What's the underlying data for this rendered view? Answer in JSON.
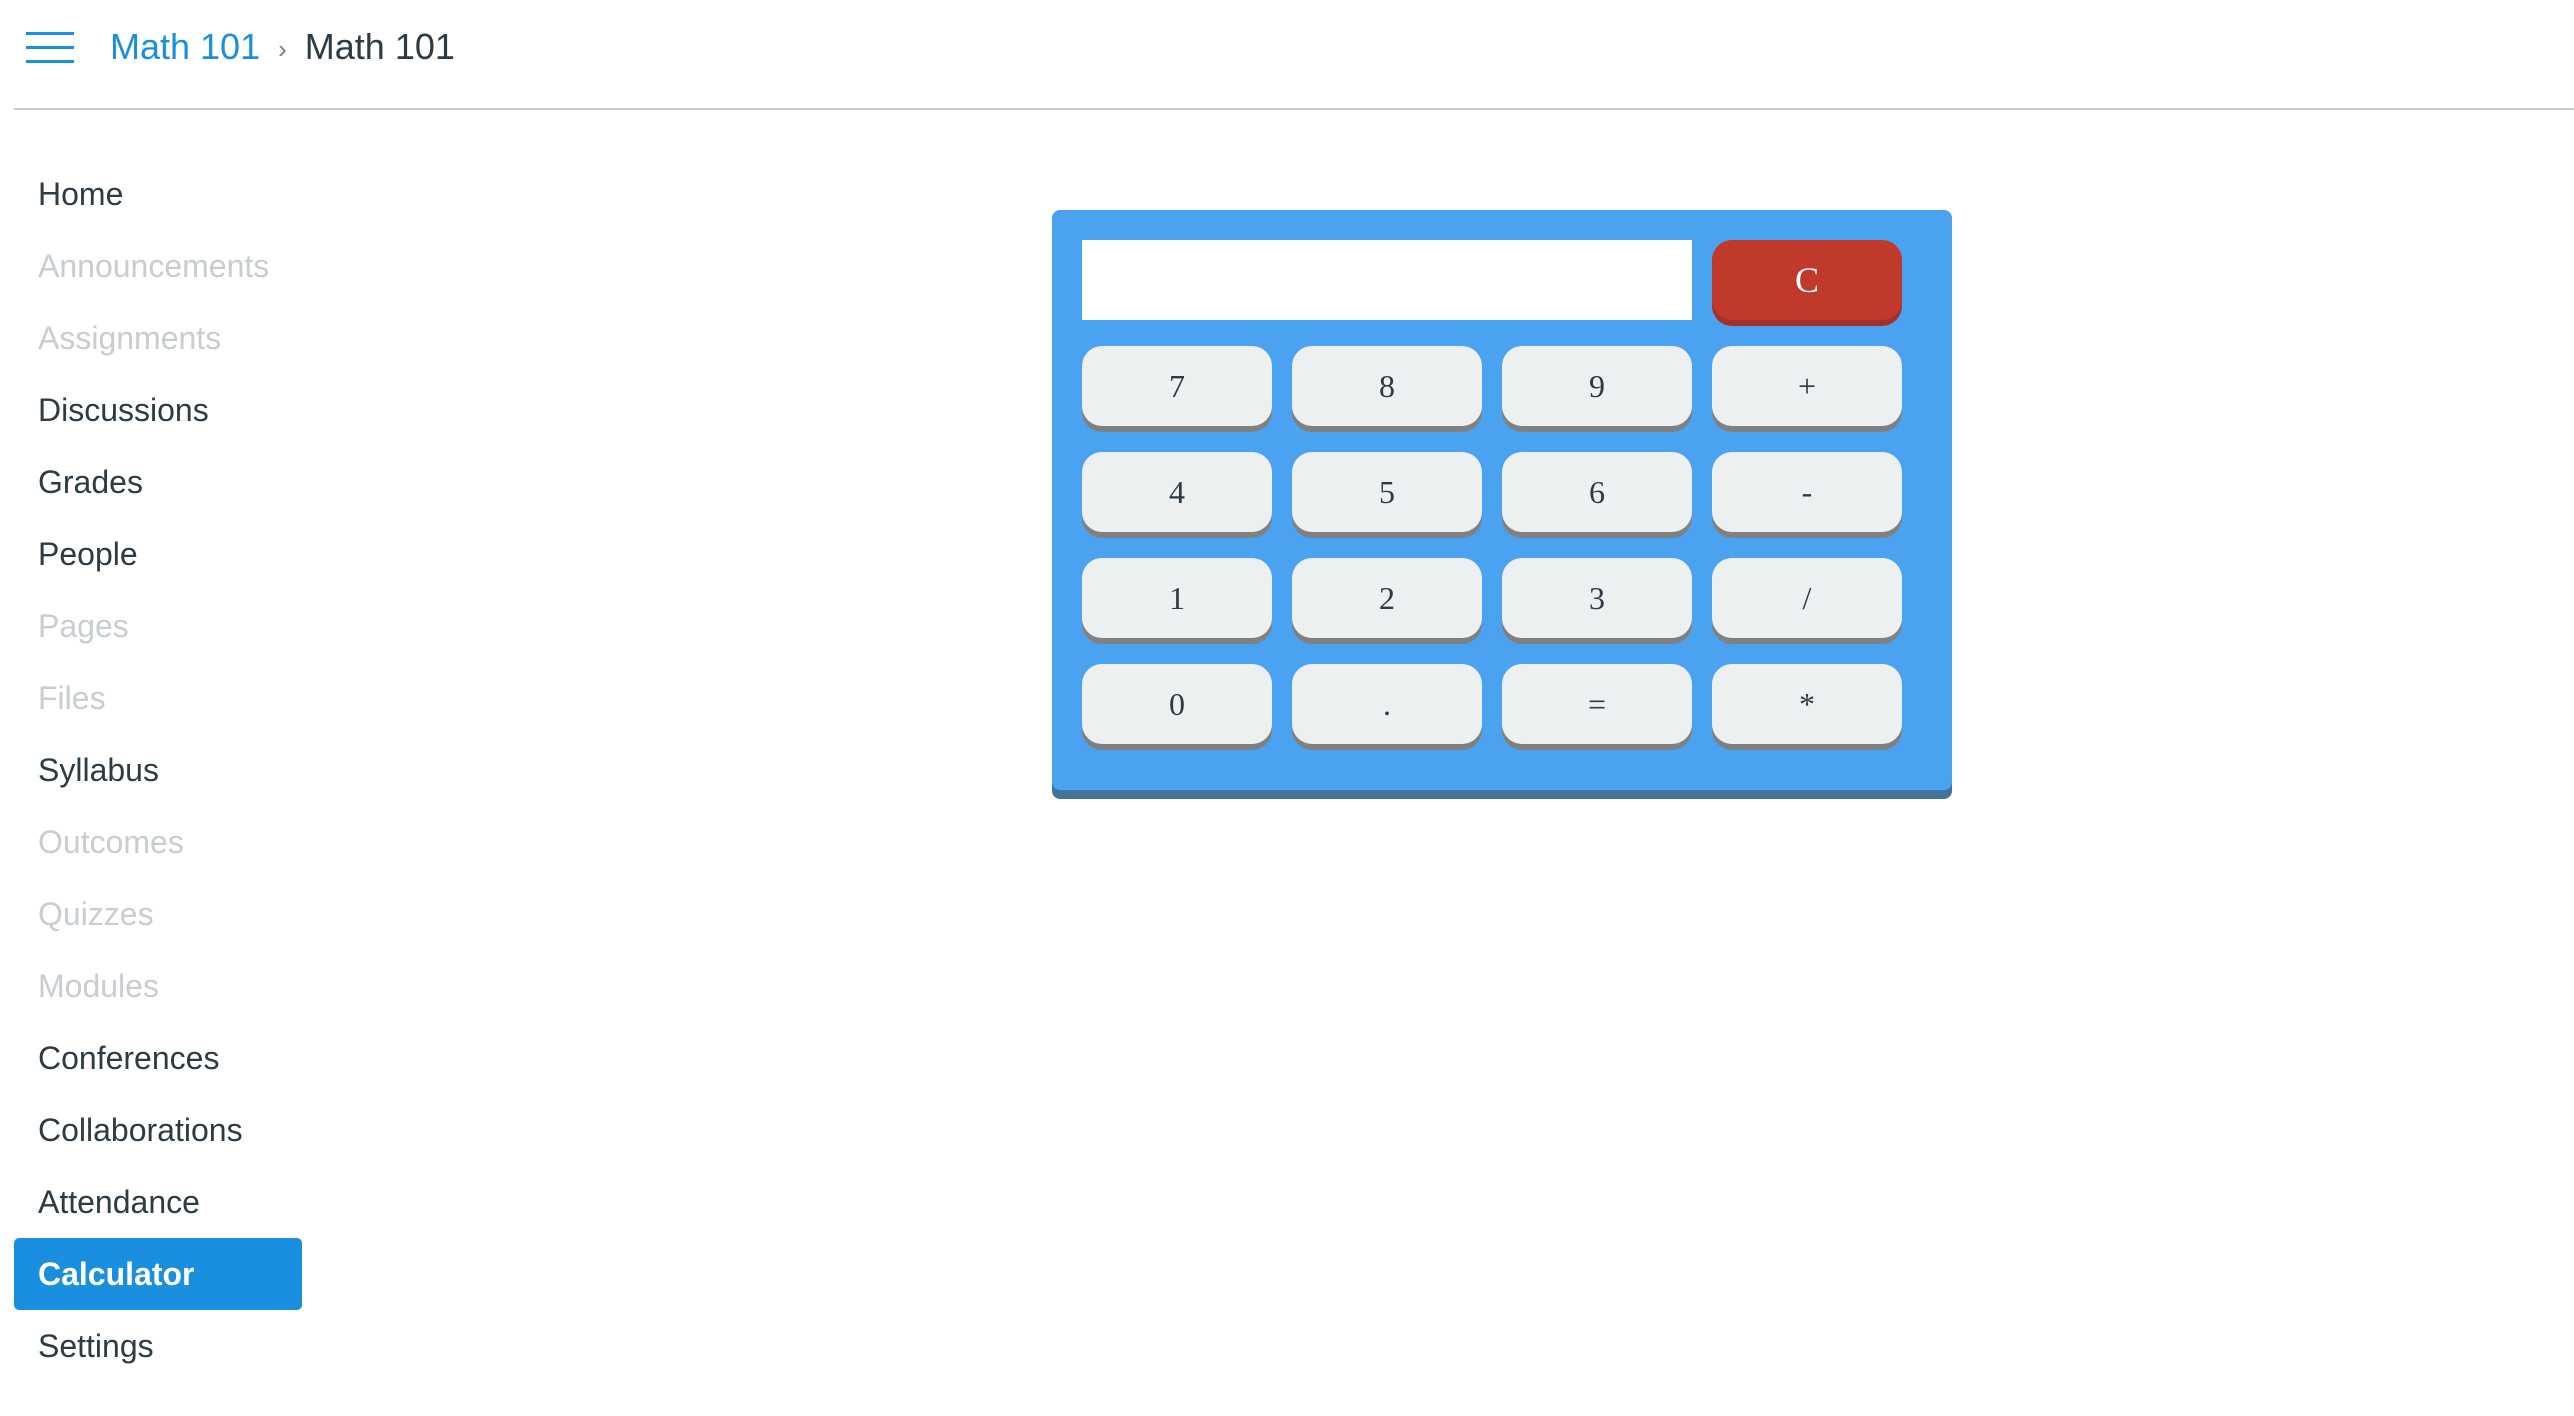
{
  "header": {
    "menu_icon": "hamburger-menu-icon",
    "breadcrumb": [
      {
        "label": "Math 101",
        "link": true
      },
      {
        "label": "Math 101",
        "link": false
      }
    ],
    "separator": "›"
  },
  "sidebar": {
    "items": [
      {
        "label": "Home",
        "state": "enabled"
      },
      {
        "label": "Announcements",
        "state": "disabled"
      },
      {
        "label": "Assignments",
        "state": "disabled"
      },
      {
        "label": "Discussions",
        "state": "enabled"
      },
      {
        "label": "Grades",
        "state": "enabled"
      },
      {
        "label": "People",
        "state": "enabled"
      },
      {
        "label": "Pages",
        "state": "disabled"
      },
      {
        "label": "Files",
        "state": "disabled"
      },
      {
        "label": "Syllabus",
        "state": "enabled"
      },
      {
        "label": "Outcomes",
        "state": "disabled"
      },
      {
        "label": "Quizzes",
        "state": "disabled"
      },
      {
        "label": "Modules",
        "state": "disabled"
      },
      {
        "label": "Conferences",
        "state": "enabled"
      },
      {
        "label": "Collaborations",
        "state": "enabled"
      },
      {
        "label": "Attendance",
        "state": "enabled"
      },
      {
        "label": "Calculator",
        "state": "active"
      },
      {
        "label": "Settings",
        "state": "enabled"
      }
    ]
  },
  "calculator": {
    "display_value": "",
    "clear_label": "C",
    "keys": [
      [
        "7",
        "8",
        "9",
        "+"
      ],
      [
        "4",
        "5",
        "6",
        "-"
      ],
      [
        "1",
        "2",
        "3",
        "/"
      ],
      [
        "0",
        ".",
        "=",
        "*"
      ]
    ]
  },
  "colors": {
    "accent": "#1a8fe0",
    "text": "#2d3b45",
    "disabled_text": "#c7cdd1",
    "calculator_body": "#4aa2f0",
    "calculator_key": "#ecf0f1",
    "clear_key": "#c0392b"
  }
}
